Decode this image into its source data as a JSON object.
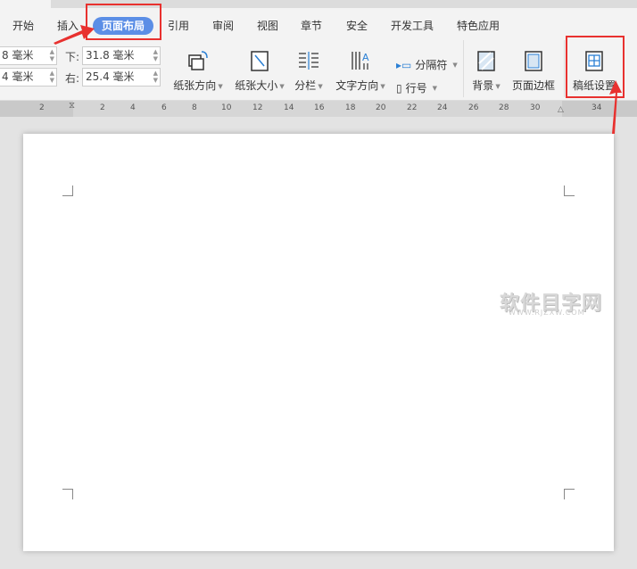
{
  "tabs": [
    "开始",
    "插入",
    "页面布局",
    "引用",
    "审阅",
    "视图",
    "章节",
    "安全",
    "开发工具",
    "特色应用"
  ],
  "active_tab": "页面布局",
  "margins": {
    "top_value": "8 毫米",
    "left_value": "4 毫米",
    "bottom_label": "下:",
    "bottom_value": "31.8 毫米",
    "right_label": "右:",
    "right_value": "25.4 毫米"
  },
  "buttons": {
    "orientation": "纸张方向",
    "size": "纸张大小",
    "columns": "分栏",
    "text_direction": "文字方向",
    "breaks": "分隔符",
    "line_numbers": "行号",
    "background": "背景",
    "page_border": "页面边框",
    "manuscript": "稿纸设置"
  },
  "ruler": [
    "2",
    "2",
    "4",
    "6",
    "8",
    "10",
    "12",
    "14",
    "16",
    "18",
    "20",
    "22",
    "24",
    "26",
    "28",
    "30",
    "34"
  ],
  "watermark": {
    "title": "软件目字网",
    "url": "WWW.RJZXW.COM"
  },
  "colors": {
    "accent": "#5b8ee6",
    "highlight": "#e8312f"
  }
}
